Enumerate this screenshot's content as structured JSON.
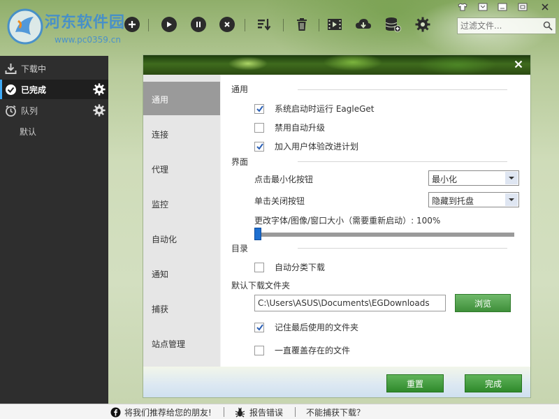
{
  "app": {
    "watermark_name": "河东软件园",
    "watermark_url": "www.pc0359.cn"
  },
  "toolbar": {
    "icons": [
      "add-icon",
      "play-icon",
      "pause-icon",
      "stop-icon",
      "sort-icon",
      "delete-icon",
      "video-icon",
      "cloud-download-icon",
      "database-add-icon",
      "settings-icon"
    ],
    "filter_placeholder": "过滤文件..."
  },
  "sidebar": {
    "items": [
      {
        "label": "下载中"
      },
      {
        "label": "已完成"
      },
      {
        "label": "队列"
      },
      {
        "label": "默认"
      }
    ]
  },
  "dialog": {
    "nav": [
      {
        "label": "通用"
      },
      {
        "label": "连接"
      },
      {
        "label": "代理"
      },
      {
        "label": "监控"
      },
      {
        "label": "自动化"
      },
      {
        "label": "通知"
      },
      {
        "label": "捕获"
      },
      {
        "label": "站点管理"
      }
    ],
    "general": {
      "title": "通用",
      "run_on_startup": {
        "label": "系统启动时运行 EagleGet",
        "checked": true
      },
      "disable_auto_update": {
        "label": "禁用自动升级",
        "checked": false
      },
      "join_ux_program": {
        "label": "加入用户体验改进计划",
        "checked": true
      }
    },
    "interface": {
      "title": "界面",
      "minimize_label": "点击最小化按钮",
      "minimize_value": "最小化",
      "close_label": "单击关闭按钮",
      "close_value": "隐藏到托盘",
      "size_label": "更改字体/图像/窗口大小（需要重新启动）: 100%",
      "size_percent": 100
    },
    "directory": {
      "title": "目录",
      "auto_classify": {
        "label": "自动分类下载",
        "checked": false
      },
      "default_folder_label": "默认下载文件夹",
      "folder_path": "C:\\Users\\ASUS\\Documents\\EGDownloads",
      "browse_label": "浏览",
      "remember_last": {
        "label": "记住最后使用的文件夹",
        "checked": true
      },
      "always_overwrite": {
        "label": "一直覆盖存在的文件",
        "checked": false
      }
    },
    "buttons": {
      "reset": "重置",
      "done": "完成"
    }
  },
  "statusbar": {
    "recommend": "将我们推荐给您的朋友!",
    "report": "报告错误",
    "cannot_capture": "不能捕获下载？"
  }
}
